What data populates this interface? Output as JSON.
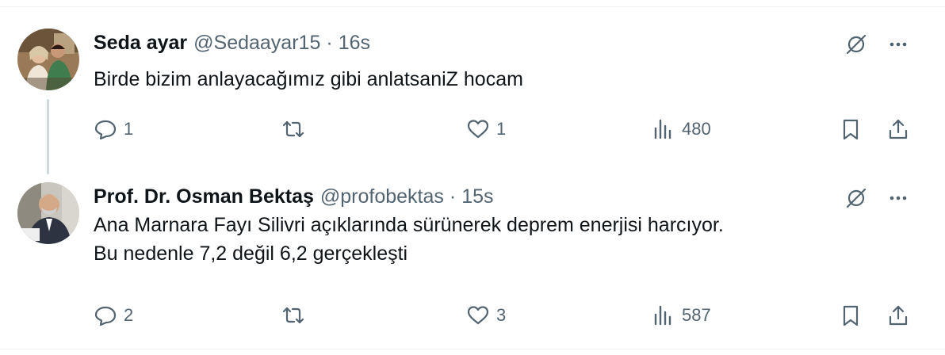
{
  "tweets": [
    {
      "name": "Seda ayar",
      "handle": "@Sedaayar15",
      "separator": "·",
      "time": "16s",
      "text_lines": [
        "Birde bizim anlayacağımız gibi anlatsaniZ hocam"
      ],
      "replies": "1",
      "retweets": "",
      "likes": "1",
      "views": "480"
    },
    {
      "name": "Prof. Dr. Osman Bektaş",
      "handle": "@profobektas",
      "separator": "·",
      "time": "15s",
      "text_lines": [
        "Ana Marnara Fayı Silivri açıklarında sürünerek deprem enerjisi harcıyor.",
        "Bu nedenle 7,2 değil 6,2 gerçekleşti"
      ],
      "replies": "2",
      "retweets": "",
      "likes": "3",
      "views": "587"
    }
  ],
  "icons": {
    "reply": "reply-icon",
    "retweet": "retweet-icon",
    "like": "heart-icon",
    "views": "views-icon",
    "bookmark": "bookmark-icon",
    "share": "share-icon",
    "grok": "grok-icon",
    "more": "more-icon"
  },
  "colors": {
    "text": "#0f1419",
    "secondary": "#536471",
    "thread_line": "#cfd9de",
    "border": "#eff3f4"
  }
}
